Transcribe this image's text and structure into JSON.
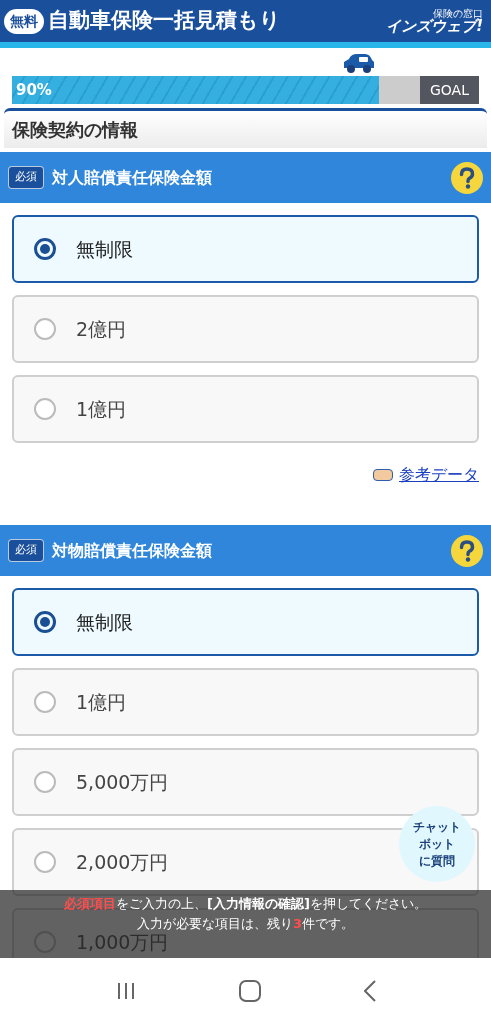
{
  "header": {
    "badge": "無料",
    "title": "自動車保険一括見積もり",
    "logo_small": "保険の窓口",
    "logo": "インズウェブ!"
  },
  "progress": {
    "level": 0.9,
    "reading": "90%",
    "goal": "GOAL"
  },
  "section_title": "保険契約の情報",
  "questions": [
    {
      "required": "必須",
      "title": "対人賠償責任保険金額",
      "options": [
        {
          "label": "無制限",
          "selected": true
        },
        {
          "label": "2億円",
          "selected": false
        },
        {
          "label": "1億円",
          "selected": false
        }
      ],
      "link": "参考データ"
    },
    {
      "required": "必須",
      "title": "対物賠償責任保険金額",
      "options": [
        {
          "label": "無制限",
          "selected": true
        },
        {
          "label": "1億円",
          "selected": false
        },
        {
          "label": "5,000万円",
          "selected": false
        },
        {
          "label": "2,000万円",
          "selected": false
        },
        {
          "label": "1,000万円",
          "selected": false
        }
      ]
    }
  ],
  "chatbot": [
    "チャット",
    "ボット",
    "に質問"
  ],
  "notice": [
    [
      {
        "text": "必須項目",
        "kind": "alert"
      },
      {
        "text": "をご入力の上、",
        "kind": "plain"
      },
      {
        "text": "[入力情報の確認]",
        "kind": "strong"
      },
      {
        "text": "を押してください。",
        "kind": "plain"
      }
    ],
    [
      {
        "text": "入力が必要な項目は、残り",
        "kind": "plain"
      },
      {
        "text": "3",
        "kind": "alert"
      },
      {
        "text": "件です。",
        "kind": "plain"
      }
    ]
  ]
}
